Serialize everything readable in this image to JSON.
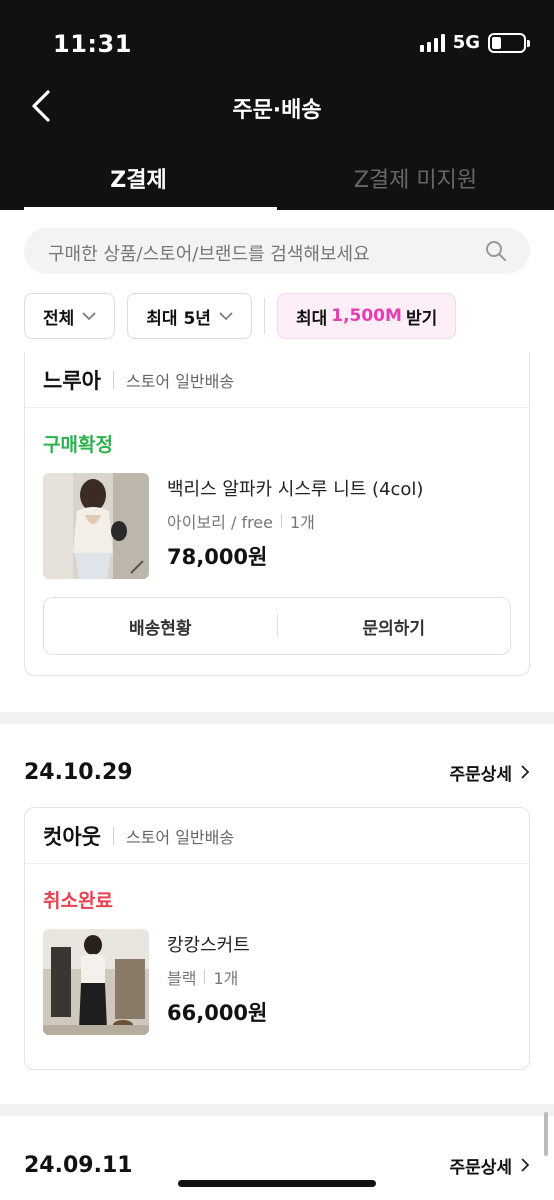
{
  "status_bar": {
    "time": "11:31",
    "network": "5G",
    "battery_level": 0.3
  },
  "nav": {
    "title": "주문·배송"
  },
  "tabs": [
    {
      "label": "Z결제",
      "active": true
    },
    {
      "label": "Z결제 미지원",
      "active": false
    }
  ],
  "search": {
    "placeholder": "구매한 상품/스토어/브랜드를 검색해보세요"
  },
  "filters": {
    "all_label": "전체",
    "period_label": "최대 5년",
    "promo_prefix": "최대",
    "promo_amount": "1,500M",
    "promo_suffix": "받기",
    "promo_accent": "#e63fb2"
  },
  "orders": [
    {
      "store": "느루아",
      "shipping_type": "스토어 일반배송",
      "status": "구매확정",
      "status_color": "#2fb14f",
      "product": "백리스 알파카 시스루 니트 (4col)",
      "option": "아이보리 / free",
      "quantity": "1개",
      "price": "78,000원",
      "buttons": [
        "배송현황",
        "문의하기"
      ]
    },
    {
      "date": "24.10.29",
      "detail_label": "주문상세",
      "store": "컷아웃",
      "shipping_type": "스토어 일반배송",
      "status": "취소완료",
      "status_color": "#e8414f",
      "product": "캉캉스커트",
      "option": "블랙",
      "quantity": "1개",
      "price": "66,000원"
    },
    {
      "date": "24.09.11",
      "detail_label": "주문상세"
    }
  ]
}
